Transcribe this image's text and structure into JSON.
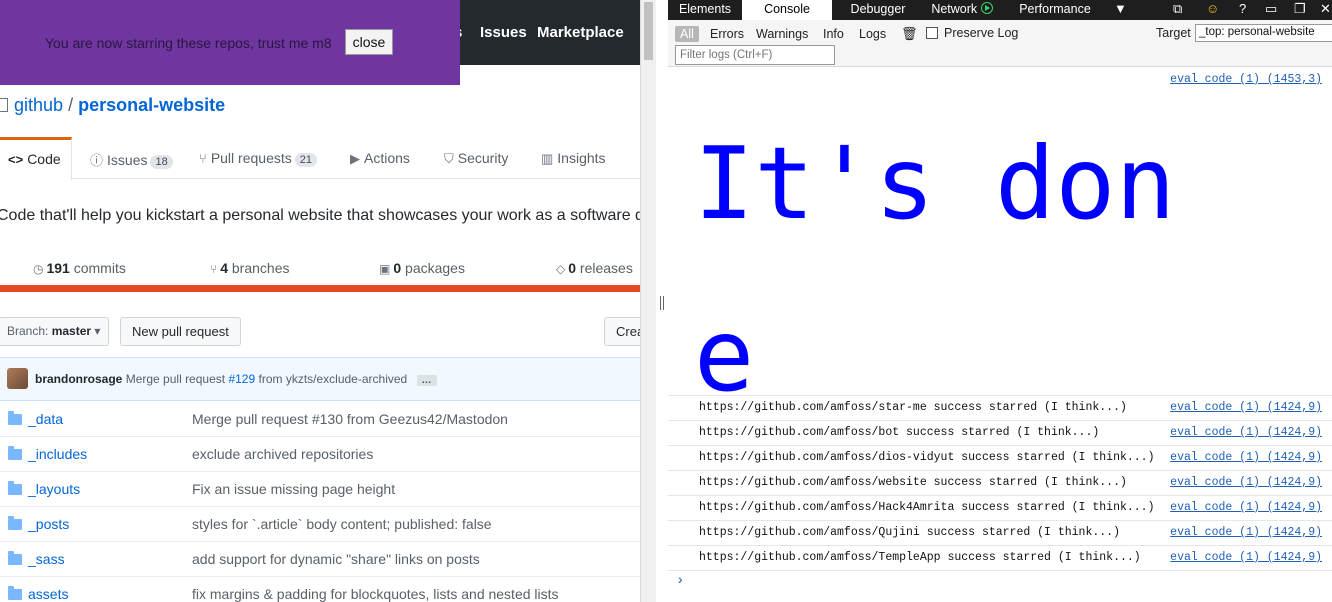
{
  "github": {
    "header_nav": [
      "s",
      "Issues",
      "Marketplace"
    ],
    "overlay": {
      "message": "You are now starring these repos, trust me m8",
      "close_label": "close"
    },
    "repo": {
      "owner": "github",
      "separator": "/",
      "name": "personal-website"
    },
    "tabs": [
      {
        "label": "Code",
        "icon": "code-icon"
      },
      {
        "label": "Issues",
        "count": "18",
        "icon": "issue-icon"
      },
      {
        "label": "Pull requests",
        "count": "21",
        "icon": "pull-request-icon"
      },
      {
        "label": "Actions",
        "icon": "play-icon"
      },
      {
        "label": "Security",
        "icon": "shield-icon"
      },
      {
        "label": "Insights",
        "icon": "graph-icon"
      }
    ],
    "description": "Code that'll help you kickstart a personal website that showcases your work as a software developer.",
    "stats": {
      "commits_count": "191",
      "commits_label": "commits",
      "branches_count": "4",
      "branches_label": "branches",
      "packages_count": "0",
      "packages_label": "packages",
      "releases_count": "0",
      "releases_label": "releases"
    },
    "branch": {
      "prefix": "Branch:",
      "name": "master"
    },
    "new_pr_label": "New pull request",
    "create_label": "Create new file",
    "commit": {
      "author": "brandonrosage",
      "text_before": "Merge pull request",
      "pr_link": "#129",
      "text_after": "from ykzts/exclude-archived",
      "ellipsis": "…"
    },
    "files": [
      {
        "name": "_data",
        "message": "Merge pull request #130 from Geezus42/Mastodon"
      },
      {
        "name": "_includes",
        "message": "exclude archived repositories"
      },
      {
        "name": "_layouts",
        "message": "Fix an issue missing page height"
      },
      {
        "name": "_posts",
        "message": "styles for `.article` body content; published: false"
      },
      {
        "name": "_sass",
        "message": "add support for dynamic \"share\" links on posts"
      },
      {
        "name": "assets",
        "message": "fix margins & padding for blockquotes, lists and nested lists"
      }
    ]
  },
  "devtools": {
    "tabs": [
      "Elements",
      "Console",
      "Debugger",
      "Network",
      "Performance"
    ],
    "active_tab": "Console",
    "filters": [
      "All",
      "Errors",
      "Warnings",
      "Info",
      "Logs"
    ],
    "preserve_log_label": "Preserve Log",
    "target_label": "Target",
    "target_value": "_top: personal-website",
    "filter_placeholder": "Filter logs (Ctrl+F)",
    "console": {
      "big_message": "It's done",
      "big_source": "eval code (1) (1453,3)",
      "logs": [
        {
          "text": "https://github.com/amfoss/star-me success starred (I think...)",
          "source": "eval code (1) (1424,9)"
        },
        {
          "text": "https://github.com/amfoss/bot success starred (I think...)",
          "source": "eval code (1) (1424,9)"
        },
        {
          "text": "https://github.com/amfoss/dios-vidyut success starred (I think...)",
          "source": "eval code (1) (1424,9)"
        },
        {
          "text": "https://github.com/amfoss/website success starred (I think...)",
          "source": "eval code (1) (1424,9)"
        },
        {
          "text": "https://github.com/amfoss/Hack4Amrita success starred (I think...)",
          "source": "eval code (1) (1424,9)"
        },
        {
          "text": "https://github.com/amfoss/Qujini success starred (I think...)",
          "source": "eval code (1) (1424,9)"
        },
        {
          "text": "https://github.com/amfoss/TempleApp success starred (I think...)",
          "source": "eval code (1) (1424,9)"
        }
      ],
      "prompt": "›"
    }
  },
  "colors": {
    "overlay": "#6f36a0",
    "github_header": "#24292e",
    "link": "#0366d6",
    "language_bar": "#e34c26",
    "console_big_text": "#0000ff"
  }
}
